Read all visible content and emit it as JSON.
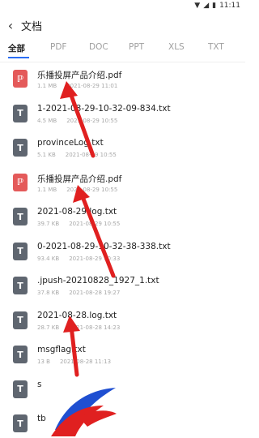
{
  "status_bar": {
    "time": "11:11"
  },
  "header": {
    "title": "文档"
  },
  "tabs": [
    {
      "label": "全部",
      "active": true
    },
    {
      "label": "PDF",
      "active": false
    },
    {
      "label": "DOC",
      "active": false
    },
    {
      "label": "PPT",
      "active": false
    },
    {
      "label": "XLS",
      "active": false
    },
    {
      "label": "TXT",
      "active": false
    }
  ],
  "files": [
    {
      "icon": "pdf-icon",
      "name": "乐播投屏产品介绍.pdf",
      "size": "1.1 MB",
      "date": "2021-08-29 11:01"
    },
    {
      "icon": "txt-icon",
      "name": "1-2021-08-29-10-32-09-834.txt",
      "size": "4.5 MB",
      "date": "2021-08-29 10:55"
    },
    {
      "icon": "txt-icon",
      "name": "provinceLog.txt",
      "size": "5.1 KB",
      "date": "2021-08-29 10:55"
    },
    {
      "icon": "pdf-icon",
      "name": "乐播投屏产品介绍.pdf",
      "size": "1.1 MB",
      "date": "2021-08-29 10:55"
    },
    {
      "icon": "txt-icon",
      "name": "2021-08-29.log.txt",
      "size": "39.7 KB",
      "date": "2021-08-29 10:55"
    },
    {
      "icon": "txt-icon",
      "name": "0-2021-08-29-10-32-38-338.txt",
      "size": "93.4 KB",
      "date": "2021-08-29 10:33"
    },
    {
      "icon": "txt-icon",
      "name": ".jpush-20210828_1927_1.txt",
      "size": "37.8 KB",
      "date": "2021-08-28 19:27"
    },
    {
      "icon": "txt-icon",
      "name": "2021-08-28.log.txt",
      "size": "28.7 KB",
      "date": "2021-08-28 14:23"
    },
    {
      "icon": "txt-icon",
      "name": "msgflag.txt",
      "size": "13 B",
      "date": "2021-08-28 11:13"
    },
    {
      "icon": "txt-icon",
      "name": "s",
      "size": "",
      "date": ""
    },
    {
      "icon": "txt-icon",
      "name": "tb",
      "size": "",
      "date": ""
    }
  ],
  "colors": {
    "accent": "#2a6df4",
    "arrow": "#e02020",
    "pdf": "#e45a5a",
    "txt": "#5f6670"
  }
}
